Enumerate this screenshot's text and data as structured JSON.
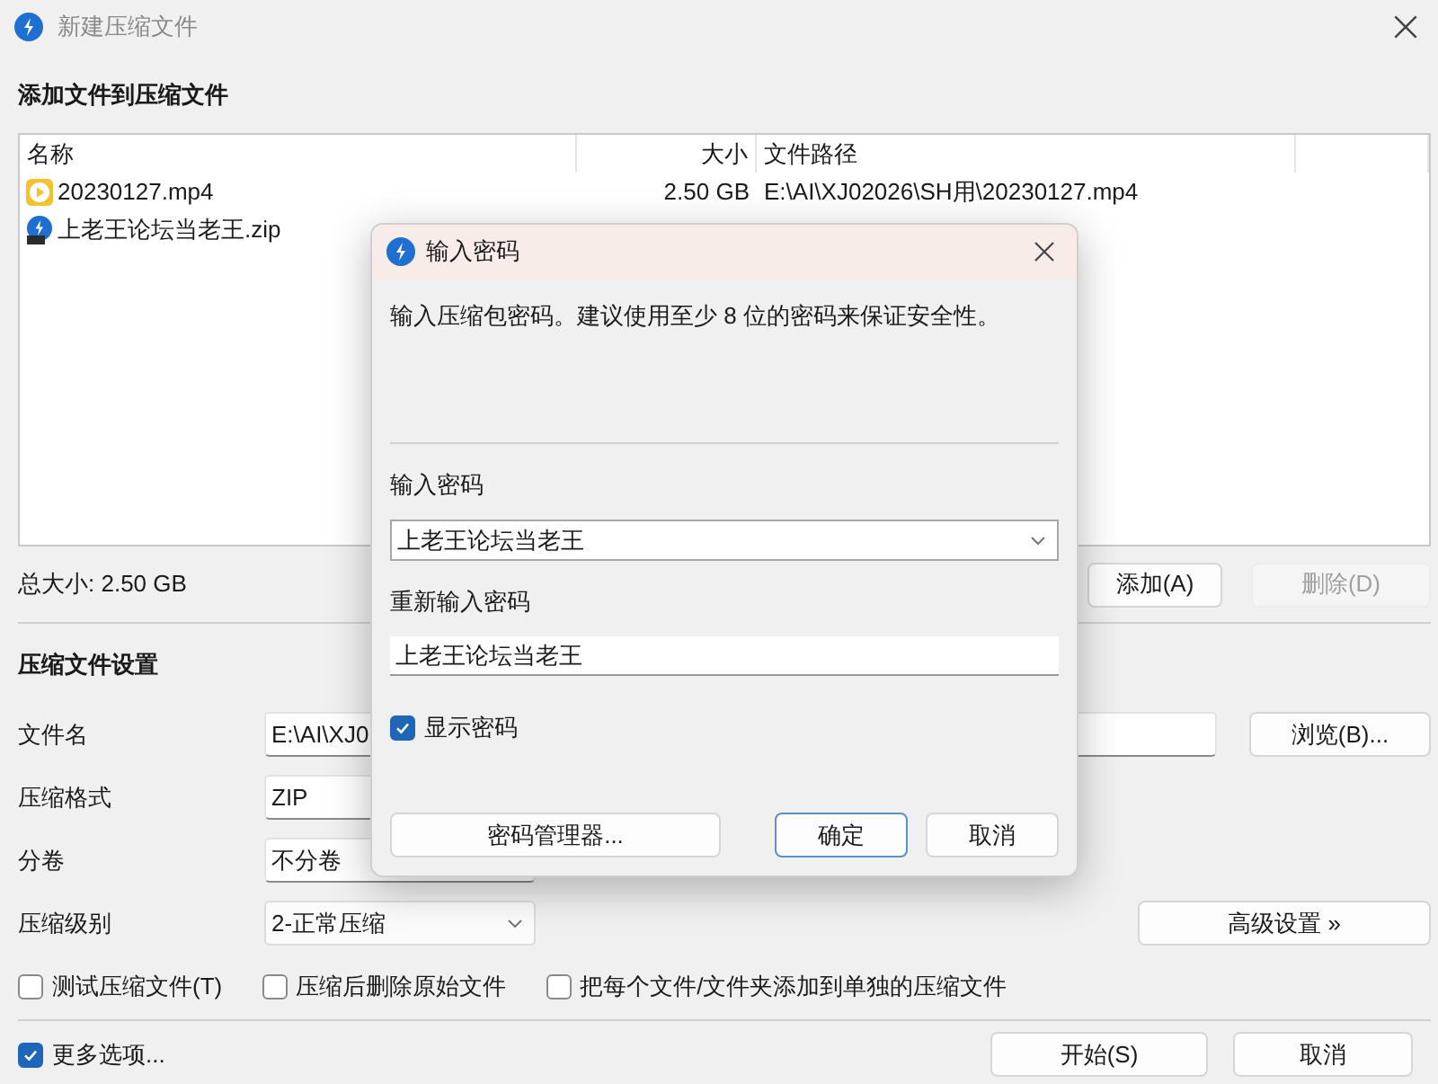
{
  "window": {
    "title": "新建压缩文件"
  },
  "files": {
    "heading": "添加文件到压缩文件",
    "columns": [
      "名称",
      "大小",
      "文件路径"
    ],
    "rows": [
      {
        "kind": "video",
        "name": "20230127.mp4",
        "size": "2.50 GB",
        "path": "E:\\AI\\XJ02026\\SH用\\20230127.mp4"
      },
      {
        "kind": "archive",
        "name": "上老王论坛当老王.zip"
      }
    ],
    "total": "总大小: 2.50 GB",
    "buttons": [
      {
        "label": "添加(A)",
        "disabled": false
      },
      {
        "label": "删除(D)",
        "disabled": true
      }
    ]
  },
  "settings": {
    "heading": "压缩文件设置",
    "browse_button": "浏览(B)...",
    "advanced_button": "高级设置 »",
    "fields": [
      {
        "kind": "path",
        "label": "文件名",
        "value": "E:\\AI\\XJ0"
      },
      {
        "kind": "plain",
        "label": "压缩格式",
        "value": "ZIP"
      },
      {
        "kind": "plain",
        "label": "分卷",
        "value": "不分卷"
      },
      {
        "kind": "select",
        "label": "压缩级别",
        "value": "2-正常压缩"
      }
    ],
    "options": [
      {
        "label": "测试压缩文件(T)",
        "checked": false
      },
      {
        "label": "压缩后删除原始文件",
        "checked": false
      },
      {
        "label": "把每个文件/文件夹添加到单独的压缩文件",
        "checked": false
      }
    ]
  },
  "more_options": {
    "label": "更多选项...",
    "checked": true
  },
  "footer_buttons": [
    "开始(S)",
    "取消"
  ],
  "dialog": {
    "title": "输入密码",
    "message": "输入压缩包密码。建议使用至少 8 位的密码来保证安全性。",
    "password_label": "输入密码",
    "password": "上老王论坛当老王",
    "confirm_label": "重新输入密码",
    "confirm": "上老王论坛当老王",
    "show_password": {
      "label": "显示密码",
      "checked": true
    },
    "manager_button": "密码管理器...",
    "ok_button": "确定",
    "cancel_button": "取消"
  }
}
